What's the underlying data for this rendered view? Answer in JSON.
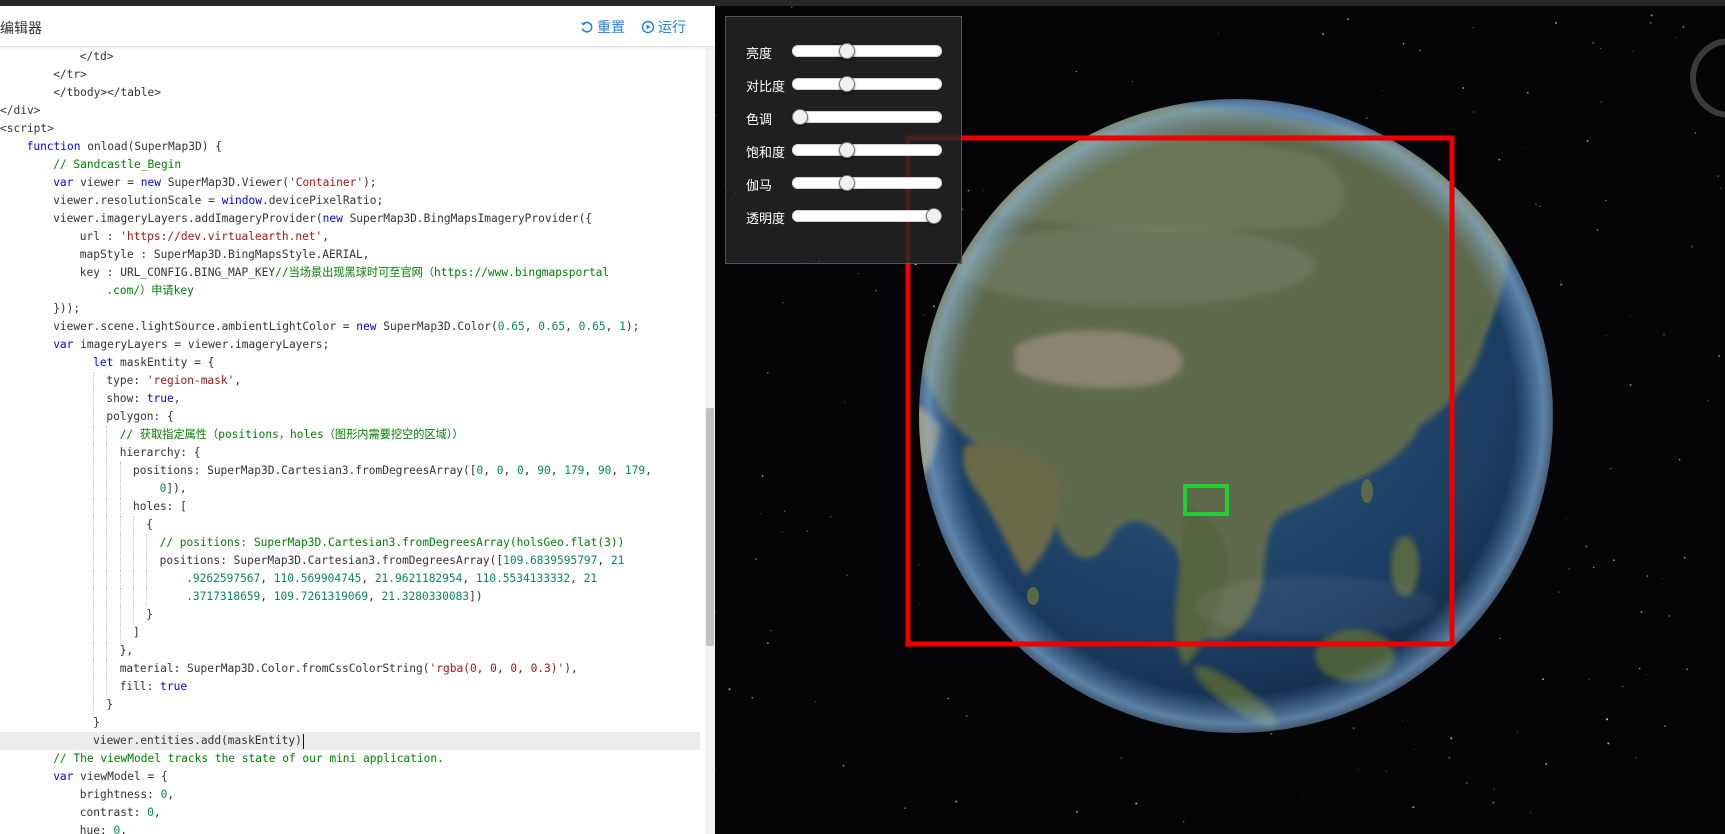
{
  "editor": {
    "title": "编辑器",
    "reset_label": "重置",
    "run_label": "运行",
    "lines": [
      {
        "indent": 6,
        "guides": [],
        "tokens": [
          {
            "t": "</td>"
          }
        ]
      },
      {
        "indent": 4,
        "guides": [],
        "tokens": [
          {
            "t": "</tr>"
          }
        ]
      },
      {
        "indent": 4,
        "guides": [],
        "tokens": [
          {
            "t": "</tbody></table>"
          }
        ]
      },
      {
        "indent": 0,
        "guides": [],
        "tokens": [
          {
            "t": "</div>"
          }
        ]
      },
      {
        "indent": 0,
        "guides": [],
        "tokens": [
          {
            "t": "<script>"
          }
        ]
      },
      {
        "indent": 2,
        "guides": [],
        "tokens": [
          {
            "t": "function ",
            "c": "kw"
          },
          {
            "t": "onload(SuperMap3D) {"
          }
        ]
      },
      {
        "indent": 4,
        "guides": [],
        "tokens": [
          {
            "t": "// Sandcastle_Begin",
            "c": "com"
          }
        ]
      },
      {
        "indent": 4,
        "guides": [],
        "tokens": [
          {
            "t": "var ",
            "c": "kw"
          },
          {
            "t": "viewer = "
          },
          {
            "t": "new ",
            "c": "kw"
          },
          {
            "t": "SuperMap3D.Viewer("
          },
          {
            "t": "'Container'",
            "c": "str"
          },
          {
            "t": ");"
          }
        ]
      },
      {
        "indent": 4,
        "guides": [],
        "tokens": [
          {
            "t": "viewer.resolutionScale = "
          },
          {
            "t": "window",
            "c": "kw"
          },
          {
            "t": ".devicePixelRatio;"
          }
        ]
      },
      {
        "indent": 4,
        "guides": [],
        "tokens": [
          {
            "t": "viewer.imageryLayers.addImageryProvider("
          },
          {
            "t": "new ",
            "c": "kw"
          },
          {
            "t": "SuperMap3D.BingMapsImageryProvider({"
          }
        ]
      },
      {
        "indent": 6,
        "guides": [],
        "tokens": [
          {
            "t": "url : "
          },
          {
            "t": "'https://dev.virtualearth.net'",
            "c": "str"
          },
          {
            "t": ","
          }
        ]
      },
      {
        "indent": 6,
        "guides": [],
        "tokens": [
          {
            "t": "mapStyle : SuperMap3D.BingMapsStyle.AERIAL,"
          }
        ]
      },
      {
        "indent": 6,
        "guides": [],
        "tokens": [
          {
            "t": "key : URL_CONFIG.BING_MAP_KEY"
          },
          {
            "t": "//当场景出现黑球时可至官网（https://www.bingmapsportal",
            "c": "com"
          }
        ]
      },
      {
        "indent": 8,
        "guides": [],
        "tokens": [
          {
            "t": ".com/）申请key",
            "c": "com"
          }
        ]
      },
      {
        "indent": 4,
        "guides": [],
        "tokens": [
          {
            "t": "}));"
          }
        ]
      },
      {
        "indent": 4,
        "guides": [],
        "tokens": [
          {
            "t": "viewer.scene.lightSource.ambientLightColor = "
          },
          {
            "t": "new ",
            "c": "kw"
          },
          {
            "t": "SuperMap3D.Color("
          },
          {
            "t": "0.65",
            "c": "num"
          },
          {
            "t": ", "
          },
          {
            "t": "0.65",
            "c": "num"
          },
          {
            "t": ", "
          },
          {
            "t": "0.65",
            "c": "num"
          },
          {
            "t": ", "
          },
          {
            "t": "1",
            "c": "num"
          },
          {
            "t": ");"
          }
        ]
      },
      {
        "indent": 4,
        "guides": [],
        "tokens": [
          {
            "t": "var ",
            "c": "kw"
          },
          {
            "t": "imageryLayers = viewer.imageryLayers;"
          }
        ]
      },
      {
        "indent": 7,
        "guides": [],
        "tokens": [
          {
            "t": "let ",
            "c": "kw"
          },
          {
            "t": "maskEntity = {"
          }
        ]
      },
      {
        "indent": 8,
        "guides": [
          7
        ],
        "tokens": [
          {
            "t": "type: "
          },
          {
            "t": "'region-mask'",
            "c": "str"
          },
          {
            "t": ","
          }
        ]
      },
      {
        "indent": 8,
        "guides": [
          7
        ],
        "tokens": [
          {
            "t": "show: "
          },
          {
            "t": "true",
            "c": "kw"
          },
          {
            "t": ","
          }
        ]
      },
      {
        "indent": 8,
        "guides": [
          7
        ],
        "tokens": [
          {
            "t": "polygon: {"
          }
        ]
      },
      {
        "indent": 9,
        "guides": [
          7,
          8
        ],
        "tokens": [
          {
            "t": "// 获取指定属性（positions，holes（图形内需要挖空的区域））",
            "c": "com"
          }
        ]
      },
      {
        "indent": 9,
        "guides": [
          7,
          8
        ],
        "tokens": [
          {
            "t": "hierarchy: {"
          }
        ]
      },
      {
        "indent": 10,
        "guides": [
          7,
          8,
          9
        ],
        "tokens": [
          {
            "t": "positions: SuperMap3D.Cartesian3.fromDegreesArray(["
          },
          {
            "t": "0",
            "c": "num"
          },
          {
            "t": ", "
          },
          {
            "t": "0",
            "c": "num"
          },
          {
            "t": ", "
          },
          {
            "t": "0",
            "c": "num"
          },
          {
            "t": ", "
          },
          {
            "t": "90",
            "c": "num"
          },
          {
            "t": ", "
          },
          {
            "t": "179",
            "c": "num"
          },
          {
            "t": ", "
          },
          {
            "t": "90",
            "c": "num"
          },
          {
            "t": ", "
          },
          {
            "t": "179",
            "c": "num"
          },
          {
            "t": ","
          }
        ]
      },
      {
        "indent": 12,
        "guides": [
          7,
          8,
          9
        ],
        "tokens": [
          {
            "t": "0",
            "c": "num"
          },
          {
            "t": "]),"
          }
        ]
      },
      {
        "indent": 10,
        "guides": [
          7,
          8,
          9
        ],
        "tokens": [
          {
            "t": "holes: ["
          }
        ]
      },
      {
        "indent": 11,
        "guides": [
          7,
          8,
          9,
          10
        ],
        "tokens": [
          {
            "t": "{"
          }
        ]
      },
      {
        "indent": 12,
        "guides": [
          7,
          8,
          9,
          10,
          11
        ],
        "tokens": [
          {
            "t": "// positions: SuperMap3D.Cartesian3.fromDegreesArray(holsGeo.flat(3))",
            "c": "com"
          }
        ]
      },
      {
        "indent": 12,
        "guides": [
          7,
          8,
          9,
          10,
          11
        ],
        "tokens": [
          {
            "t": "positions: SuperMap3D.Cartesian3.fromDegreesArray(["
          },
          {
            "t": "109.6839595797",
            "c": "num"
          },
          {
            "t": ", "
          },
          {
            "t": "21",
            "c": "num"
          }
        ]
      },
      {
        "indent": 14,
        "guides": [
          7,
          8,
          9,
          10,
          11
        ],
        "tokens": [
          {
            "t": ".9262597567",
            "c": "num"
          },
          {
            "t": ", "
          },
          {
            "t": "110.569904745",
            "c": "num"
          },
          {
            "t": ", "
          },
          {
            "t": "21.9621182954",
            "c": "num"
          },
          {
            "t": ", "
          },
          {
            "t": "110.5534133332",
            "c": "num"
          },
          {
            "t": ", "
          },
          {
            "t": "21",
            "c": "num"
          }
        ]
      },
      {
        "indent": 14,
        "guides": [
          7,
          8,
          9,
          10,
          11
        ],
        "tokens": [
          {
            "t": ".3717318659",
            "c": "num"
          },
          {
            "t": ", "
          },
          {
            "t": "109.7261319069",
            "c": "num"
          },
          {
            "t": ", "
          },
          {
            "t": "21.3280330083",
            "c": "num"
          },
          {
            "t": "])"
          }
        ]
      },
      {
        "indent": 11,
        "guides": [
          7,
          8,
          9,
          10
        ],
        "tokens": [
          {
            "t": "}"
          }
        ]
      },
      {
        "indent": 10,
        "guides": [
          7,
          8,
          9
        ],
        "tokens": [
          {
            "t": "]"
          }
        ]
      },
      {
        "indent": 9,
        "guides": [
          7,
          8
        ],
        "tokens": [
          {
            "t": "},"
          }
        ]
      },
      {
        "indent": 9,
        "guides": [
          7,
          8
        ],
        "tokens": [
          {
            "t": "material: SuperMap3D.Color.fromCssColorString("
          },
          {
            "t": "'rgba(0, 0, 0, 0.3)'",
            "c": "str"
          },
          {
            "t": "),"
          }
        ]
      },
      {
        "indent": 9,
        "guides": [
          7,
          8
        ],
        "tokens": [
          {
            "t": "fill: "
          },
          {
            "t": "true",
            "c": "kw"
          }
        ]
      },
      {
        "indent": 8,
        "guides": [
          7
        ],
        "tokens": [
          {
            "t": "}"
          }
        ]
      },
      {
        "indent": 7,
        "guides": [],
        "tokens": [
          {
            "t": "}"
          }
        ]
      },
      {
        "indent": 7,
        "guides": [],
        "active": true,
        "tokens": [
          {
            "t": "viewer.entities.add(maskEntity)"
          }
        ]
      },
      {
        "indent": 4,
        "guides": [],
        "tokens": [
          {
            "t": "// The viewModel tracks the state of our mini application.",
            "c": "com"
          }
        ]
      },
      {
        "indent": 4,
        "guides": [],
        "tokens": [
          {
            "t": "var ",
            "c": "kw"
          },
          {
            "t": "viewModel = {"
          }
        ]
      },
      {
        "indent": 6,
        "guides": [],
        "tokens": [
          {
            "t": "brightness: "
          },
          {
            "t": "0",
            "c": "num"
          },
          {
            "t": ","
          }
        ]
      },
      {
        "indent": 6,
        "guides": [],
        "tokens": [
          {
            "t": "contrast: "
          },
          {
            "t": "0",
            "c": "num"
          },
          {
            "t": ","
          }
        ]
      },
      {
        "indent": 6,
        "guides": [],
        "tokens": [
          {
            "t": "hue: "
          },
          {
            "t": "0",
            "c": "num"
          },
          {
            "t": ","
          }
        ]
      }
    ]
  },
  "controls": [
    {
      "label": "亮度",
      "value": 0.35
    },
    {
      "label": "对比度",
      "value": 0.35
    },
    {
      "label": "色调",
      "value": 0.0
    },
    {
      "label": "饱和度",
      "value": 0.35
    },
    {
      "label": "伽马",
      "value": 0.35
    },
    {
      "label": "透明度",
      "value": 1.0
    }
  ],
  "colors": {
    "accent": "#1e82e6",
    "mask_outline": "#ee0000",
    "hole_outline": "#22cc33"
  }
}
